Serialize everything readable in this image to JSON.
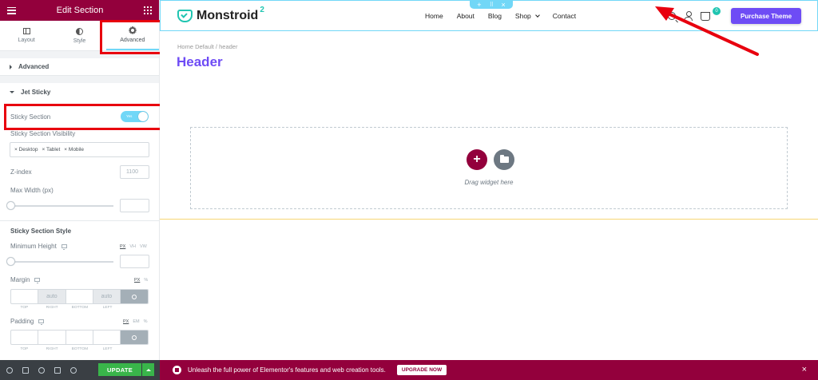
{
  "panel": {
    "title": "Edit Section",
    "tabs": [
      {
        "label": "Layout",
        "icon": "columns-icon"
      },
      {
        "label": "Style",
        "icon": "half-circle-icon"
      },
      {
        "label": "Advanced",
        "icon": "gear-icon"
      }
    ],
    "active_tab": "Advanced",
    "sections": {
      "advanced": "Advanced",
      "jet_sticky": "Jet Sticky"
    },
    "sticky_section": {
      "label": "Sticky Section",
      "toggle_text": "Yes",
      "enabled": true
    },
    "visibility": {
      "label": "Sticky Section Visibility",
      "chips": [
        "× Desktop",
        "× Tablet",
        "× Mobile"
      ]
    },
    "z_index": {
      "label": "Z-index",
      "placeholder": "1100"
    },
    "max_width": {
      "label": "Max Width (px)"
    },
    "sticky_style": {
      "label": "Sticky Section Style"
    },
    "min_height": {
      "label": "Minimum Height",
      "units": [
        "PX",
        "VH",
        "VW"
      ]
    },
    "margin": {
      "label": "Margin",
      "units": [
        "PX",
        "%"
      ],
      "values": [
        "",
        "auto",
        "",
        "auto"
      ],
      "sides": [
        "TOP",
        "RIGHT",
        "BOTTOM",
        "LEFT"
      ]
    },
    "padding": {
      "label": "Padding",
      "units": [
        "PX",
        "EM",
        "%"
      ],
      "sides": [
        "TOP",
        "RIGHT",
        "BOTTOM",
        "LEFT"
      ]
    },
    "footer": {
      "update_label": "UPDATE"
    }
  },
  "site": {
    "logo_text": "Monstroid",
    "logo_sup": "2",
    "nav": [
      "Home",
      "About",
      "Blog",
      "Shop",
      "Contact"
    ],
    "cart_count": "0",
    "purchase_label": "Purchase Theme",
    "handle": {
      "add": "+",
      "move": "⠿",
      "close": "×"
    }
  },
  "page": {
    "breadcrumb": "Home Default  /  header",
    "title": "Header",
    "drag_text": "Drag widget here",
    "add_symbol": "+"
  },
  "promo": {
    "text": "Unleash the full power of Elementor's features and web creation tools.",
    "button": "UPGRADE NOW",
    "close": "×"
  },
  "colors": {
    "brand": "#93003c",
    "accent": "#71d7f7",
    "purple": "#6e4cf5",
    "teal": "#20c5b1",
    "annotation": "#e8000e"
  }
}
